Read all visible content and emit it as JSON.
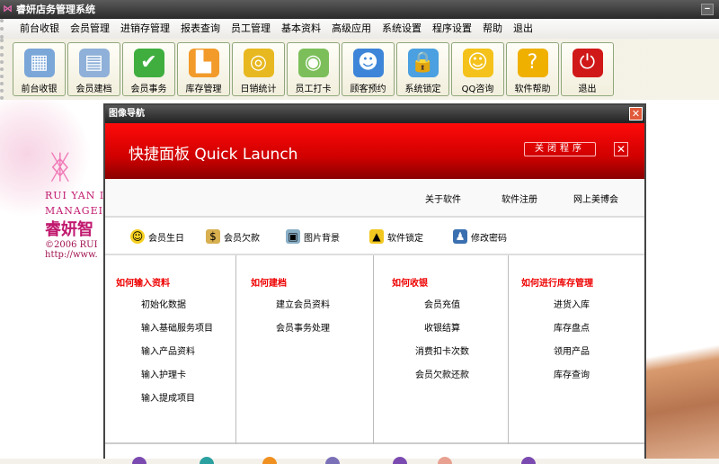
{
  "app": {
    "title": "睿妍店务管理系统",
    "minimize": "‒"
  },
  "menu": [
    "前台收银",
    "会员管理",
    "进销存管理",
    "报表查询",
    "员工管理",
    "基本资料",
    "高级应用",
    "系统设置",
    "程序设置",
    "帮助",
    "退出"
  ],
  "toolbar": [
    {
      "label": "前台收银",
      "icon": "calculator-icon",
      "glyph": "▦",
      "color": "#7aa6d8"
    },
    {
      "label": "会员建档",
      "icon": "member-card-icon",
      "glyph": "▤",
      "color": "#8fb0d8"
    },
    {
      "label": "会员事务",
      "icon": "folder-icon",
      "glyph": "✔",
      "color": "#3fae3f"
    },
    {
      "label": "库存管理",
      "icon": "factory-icon",
      "glyph": "▙",
      "color": "#f29a2a"
    },
    {
      "label": "日销统计",
      "icon": "coins-icon",
      "glyph": "◎",
      "color": "#e8b820"
    },
    {
      "label": "员工打卡",
      "icon": "user-clock-icon",
      "glyph": "◉",
      "color": "#7cbf5a"
    },
    {
      "label": "顾客预约",
      "icon": "customer-icon",
      "glyph": "☻",
      "color": "#3d85d8"
    },
    {
      "label": "系统锁定",
      "icon": "lock-icon",
      "glyph": "🔒",
      "color": "#4aa0e0"
    },
    {
      "label": "QQ咨询",
      "icon": "qq-smiley-icon",
      "glyph": "☺",
      "color": "#f4c21a"
    },
    {
      "label": "软件帮助",
      "icon": "help-question-icon",
      "glyph": "?",
      "color": "#f0b000"
    },
    {
      "label": "退出",
      "icon": "power-icon",
      "glyph": "⏻",
      "color": "#d01818"
    }
  ],
  "background": {
    "logo_line1": "RUI YAN I",
    "logo_line2": "MANAGEI",
    "logo_cn": "睿妍智",
    "logo_copy": "©2006 RUI",
    "logo_url": "http://www."
  },
  "dialog": {
    "title": "图像导航",
    "header": "快捷面板  Quick Launch",
    "close_program": "关闭程序",
    "links": [
      "关于软件",
      "软件注册",
      "网上美博会"
    ],
    "shortcuts": [
      {
        "label": "会员生日",
        "icon": "smiley-icon"
      },
      {
        "label": "会员欠款",
        "icon": "money-icon"
      },
      {
        "label": "图片背景",
        "icon": "picture-icon"
      },
      {
        "label": "软件锁定",
        "icon": "padlock-icon"
      },
      {
        "label": "修改密码",
        "icon": "user-password-icon"
      }
    ],
    "columns": [
      {
        "title": "如何输入资料",
        "items": [
          "初始化数据",
          "输入基础服务项目",
          "输入产品资料",
          "输入护理卡",
          "输入提成项目"
        ]
      },
      {
        "title": "如何建档",
        "items": [
          "建立会员资料",
          "会员事务处理"
        ]
      },
      {
        "title": "如何收银",
        "items": [
          "会员充值",
          "收银结算",
          "消费扣卡次数",
          "会员欠款还款"
        ]
      },
      {
        "title": "如何进行库存管理",
        "items": [
          "进货入库",
          "库存盘点",
          "领用产品",
          "库存查询"
        ]
      }
    ]
  }
}
